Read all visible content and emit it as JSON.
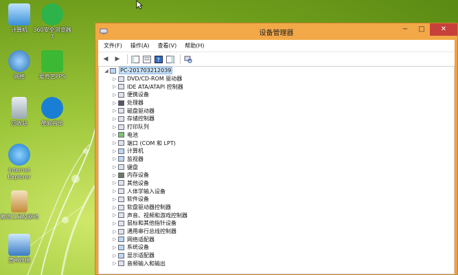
{
  "desktop": {
    "icons": [
      {
        "label": "计算机"
      },
      {
        "label": "360安全浏览器7"
      },
      {
        "label": "网络"
      },
      {
        "label": "爱奇艺PPS"
      },
      {
        "label": "回收站"
      },
      {
        "label": "酷狗音乐"
      },
      {
        "label": "Internet Explorer"
      },
      {
        "label": "激活工具及驱动"
      },
      {
        "label": "宽带连接"
      }
    ]
  },
  "window": {
    "title": "设备管理器",
    "controls": {
      "minimize": "−",
      "maximize": "□",
      "close": "✕"
    },
    "menu": [
      "文件(F)",
      "操作(A)",
      "查看(V)",
      "帮助(H)"
    ],
    "tree": {
      "root": "PC-20170321203​9",
      "children": [
        "DVD/CD-ROM 驱动器",
        "IDE ATA/ATAPI 控制器",
        "便携设备",
        "处理器",
        "磁盘驱动器",
        "存储控制器",
        "打印队列",
        "电池",
        "端口 (COM 和 LPT)",
        "计算机",
        "监视器",
        "键盘",
        "内存设备",
        "其他设备",
        "人体学输入设备",
        "软件设备",
        "软盘驱动器控制器",
        "声音、视频和游戏控制器",
        "鼠标和其他指针设备",
        "通用串行总线控制器",
        "网络适配器",
        "系统设备",
        "显示适配器",
        "音频输入和输出"
      ]
    }
  }
}
